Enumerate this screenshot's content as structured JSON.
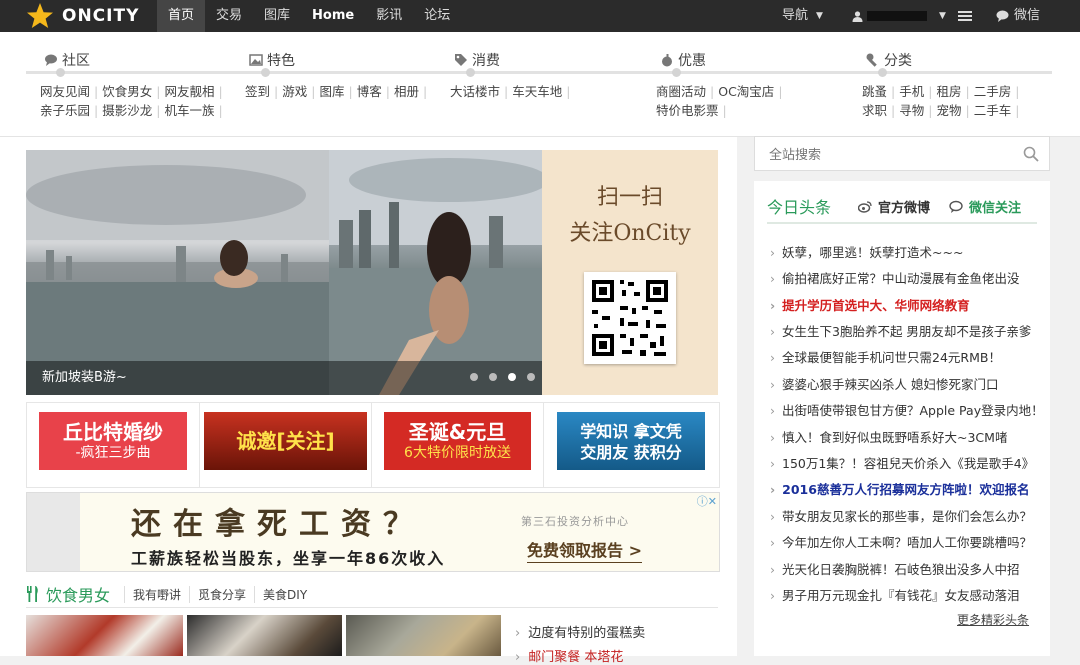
{
  "topbar": {
    "logo_text": "ONCITY",
    "nav": [
      {
        "label": "首页"
      },
      {
        "label": "交易"
      },
      {
        "label": "图库"
      },
      {
        "label": "Home"
      },
      {
        "label": "影讯"
      },
      {
        "label": "论坛"
      }
    ],
    "right": {
      "menu_label": "导航",
      "weixin_label": "微信"
    }
  },
  "categories": [
    {
      "title": "社区",
      "icon": "chat-icon",
      "rows": [
        [
          "网友见闻",
          "饮食男女",
          "网友靓相"
        ],
        [
          "亲子乐园",
          "摄影沙龙",
          "机车一族"
        ]
      ]
    },
    {
      "title": "特色",
      "icon": "image-icon",
      "rows": [
        [
          "签到",
          "游戏",
          "图库",
          "博客",
          "相册"
        ]
      ]
    },
    {
      "title": "消费",
      "icon": "tag-icon",
      "rows": [
        [
          "大话楼市",
          "车天车地"
        ]
      ]
    },
    {
      "title": "优惠",
      "icon": "apple-icon",
      "rows": [
        [
          "商圈活动",
          "OC淘宝店"
        ],
        [
          "特价电影票"
        ]
      ]
    },
    {
      "title": "分类",
      "icon": "wrench-icon",
      "rows": [
        [
          "跳蚤",
          "手机",
          "租房",
          "二手房"
        ],
        [
          "求职",
          "寻物",
          "宠物",
          "二手车"
        ]
      ]
    }
  ],
  "banner": {
    "caption": "新加坡装B游~",
    "qr_text_line1": "扫一扫",
    "qr_text_line2": "关注OnCity",
    "slides": 4,
    "active_slide": 3
  },
  "ads": [
    {
      "line1": "丘比特婚纱",
      "line2": "-疯狂三步曲",
      "bg": "#e8424a",
      "fg": "#ffffff"
    },
    {
      "line1": "诚邀[关注]",
      "line2": "",
      "bg": "#b8261a",
      "fg": "#ffe24a"
    },
    {
      "line1": "圣诞&元旦",
      "line2": "6大特价限时放送",
      "bg": "#d42a24",
      "fg": "#ffffff"
    },
    {
      "line1": "学知识 拿文凭",
      "line2": "交朋友 获积分",
      "bg": "#1e6fa8",
      "fg": "#ffffff"
    }
  ],
  "wide_ad": {
    "headline": "还在拿死工资？",
    "subline": "工薪族轻松当股东，坐享一年86次收入",
    "tag": "第三石投资分析中心",
    "cta": "免费领取报告 >"
  },
  "food": {
    "title": "饮食男女",
    "tabs": [
      "我有嘢讲",
      "觅食分享",
      "美食DIY"
    ],
    "items": [
      "边度有特别的蛋糕卖",
      "邮门聚餐 本塔花"
    ]
  },
  "search": {
    "placeholder": "全站搜索"
  },
  "sidebar": {
    "title": "今日头条",
    "btn_weibo": "官方微博",
    "btn_weixin": "微信关注",
    "news": [
      {
        "text": "妖孽，哪里逃！妖孽打造术~~~",
        "style": "normal"
      },
      {
        "text": "偷拍裙底好正常？中山动漫展有金鱼佬出没",
        "style": "normal"
      },
      {
        "text": "提升学历首选中大、华师网络教育",
        "style": "red"
      },
      {
        "text": "女生生下3胞胎养不起 男朋友却不是孩子亲爹",
        "style": "normal"
      },
      {
        "text": "全球最便智能手机问世只需24元RMB！",
        "style": "normal"
      },
      {
        "text": "婆婆心狠手辣买凶杀人 媳妇惨死家门口",
        "style": "normal"
      },
      {
        "text": "出街唔使带银包甘方便？Apple Pay登录内地！",
        "style": "normal"
      },
      {
        "text": "慎入！食到好似虫既野唔系好大~3CM啫",
        "style": "normal"
      },
      {
        "text": "150万1集？！容祖兒天价杀入《我是歌手4》",
        "style": "normal"
      },
      {
        "text": "2016慈善万人行招募网友方阵啦！欢迎报名",
        "style": "blue"
      },
      {
        "text": "带女朋友见家长的那些事，是你们会怎么办？",
        "style": "normal"
      },
      {
        "text": "今年加左你人工未啊？唔加人工你要跳槽吗？",
        "style": "normal"
      },
      {
        "text": "光天化日袭胸脱裤！石岐色狼出没多人中招",
        "style": "normal"
      },
      {
        "text": "男子用万元现金扎『有钱花』女友感动落泪",
        "style": "normal"
      }
    ],
    "more": "更多精彩头条"
  }
}
